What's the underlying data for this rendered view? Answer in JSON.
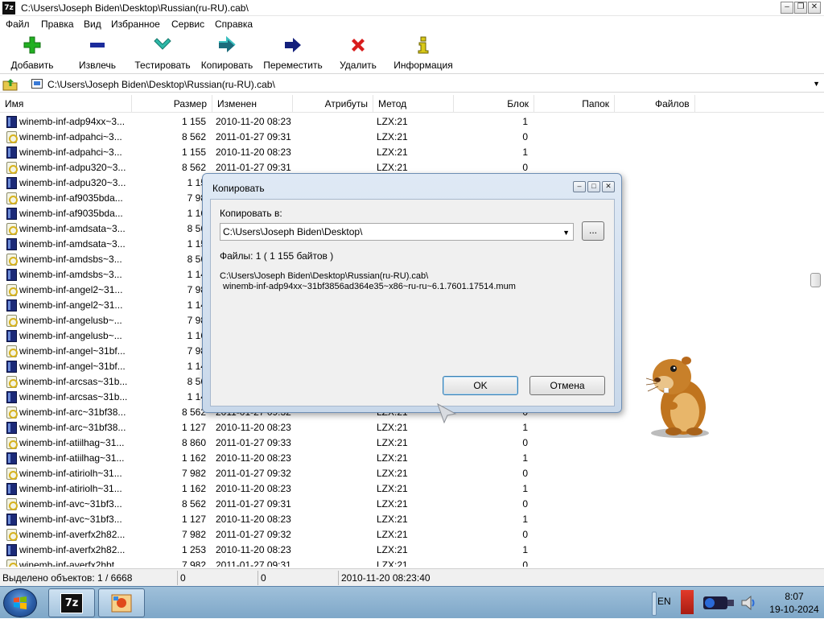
{
  "window": {
    "title": "C:\\Users\\Joseph Biden\\Desktop\\Russian(ru-RU).cab\\",
    "app_icon_text": "7z"
  },
  "menu": [
    "Файл",
    "Правка",
    "Вид",
    "Избранное",
    "Сервис",
    "Справка"
  ],
  "toolbar": [
    {
      "label": "Добавить",
      "icon": "plus-icon",
      "color": "#22b022"
    },
    {
      "label": "Извлечь",
      "icon": "minus-icon",
      "color": "#1c2c9c"
    },
    {
      "label": "Тестировать",
      "icon": "check-icon",
      "color": "#2eb8a8"
    },
    {
      "label": "Копировать",
      "icon": "copy-arrow-icon",
      "color": "#1c6c7c"
    },
    {
      "label": "Переместить",
      "icon": "move-arrow-icon",
      "color": "#14207c"
    },
    {
      "label": "Удалить",
      "icon": "delete-x-icon",
      "color": "#d81c1c"
    },
    {
      "label": "Информация",
      "icon": "info-icon",
      "color": "#d8c818"
    }
  ],
  "address": "C:\\Users\\Joseph Biden\\Desktop\\Russian(ru-RU).cab\\",
  "columns": [
    "Имя",
    "Размер",
    "Изменен",
    "Атрибуты",
    "Метод",
    "Блок",
    "Папок",
    "Файлов"
  ],
  "rows": [
    {
      "name": "winemb-inf-adp94xx~3...",
      "size": "1 155",
      "modified": "2010-11-20 08:23",
      "method": "LZX:21",
      "block": "1",
      "icon": "doc"
    },
    {
      "name": "winemb-inf-adpahci~3...",
      "size": "8 562",
      "modified": "2011-01-27 09:31",
      "method": "LZX:21",
      "block": "0",
      "icon": "cfg"
    },
    {
      "name": "winemb-inf-adpahci~3...",
      "size": "1 155",
      "modified": "2010-11-20 08:23",
      "method": "LZX:21",
      "block": "1",
      "icon": "doc"
    },
    {
      "name": "winemb-inf-adpu320~3...",
      "size": "8 562",
      "modified": "2011-01-27 09:31",
      "method": "LZX:21",
      "block": "0",
      "icon": "cfg"
    },
    {
      "name": "winemb-inf-adpu320~3...",
      "size": "1 15",
      "modified": "",
      "method": "",
      "block": "",
      "icon": "doc"
    },
    {
      "name": "winemb-inf-af9035bda...",
      "size": "7 98",
      "modified": "",
      "method": "",
      "block": "",
      "icon": "cfg"
    },
    {
      "name": "winemb-inf-af9035bda...",
      "size": "1 16",
      "modified": "",
      "method": "",
      "block": "",
      "icon": "doc"
    },
    {
      "name": "winemb-inf-amdsata~3...",
      "size": "8 56",
      "modified": "",
      "method": "",
      "block": "",
      "icon": "cfg"
    },
    {
      "name": "winemb-inf-amdsata~3...",
      "size": "1 15",
      "modified": "",
      "method": "",
      "block": "",
      "icon": "doc"
    },
    {
      "name": "winemb-inf-amdsbs~3...",
      "size": "8 56",
      "modified": "",
      "method": "",
      "block": "",
      "icon": "cfg"
    },
    {
      "name": "winemb-inf-amdsbs~3...",
      "size": "1 14",
      "modified": "",
      "method": "",
      "block": "",
      "icon": "doc"
    },
    {
      "name": "winemb-inf-angel2~31...",
      "size": "7 98",
      "modified": "",
      "method": "",
      "block": "",
      "icon": "cfg"
    },
    {
      "name": "winemb-inf-angel2~31...",
      "size": "1 14",
      "modified": "",
      "method": "",
      "block": "",
      "icon": "doc"
    },
    {
      "name": "winemb-inf-angelusb~...",
      "size": "7 98",
      "modified": "",
      "method": "",
      "block": "",
      "icon": "cfg"
    },
    {
      "name": "winemb-inf-angelusb~...",
      "size": "1 16",
      "modified": "",
      "method": "",
      "block": "",
      "icon": "doc"
    },
    {
      "name": "winemb-inf-angel~31bf...",
      "size": "7 98",
      "modified": "",
      "method": "",
      "block": "",
      "icon": "cfg"
    },
    {
      "name": "winemb-inf-angel~31bf...",
      "size": "1 14",
      "modified": "",
      "method": "",
      "block": "",
      "icon": "doc"
    },
    {
      "name": "winemb-inf-arcsas~31b...",
      "size": "8 56",
      "modified": "",
      "method": "",
      "block": "",
      "icon": "cfg"
    },
    {
      "name": "winemb-inf-arcsas~31b...",
      "size": "1 14",
      "modified": "",
      "method": "",
      "block": "",
      "icon": "doc"
    },
    {
      "name": "winemb-inf-arc~31bf38...",
      "size": "8 562",
      "modified": "2011-01-27 09:32",
      "method": "LZX:21",
      "block": "0",
      "icon": "cfg"
    },
    {
      "name": "winemb-inf-arc~31bf38...",
      "size": "1 127",
      "modified": "2010-11-20 08:23",
      "method": "LZX:21",
      "block": "1",
      "icon": "doc"
    },
    {
      "name": "winemb-inf-atiilhag~31...",
      "size": "8 860",
      "modified": "2011-01-27 09:33",
      "method": "LZX:21",
      "block": "0",
      "icon": "cfg"
    },
    {
      "name": "winemb-inf-atiilhag~31...",
      "size": "1 162",
      "modified": "2010-11-20 08:23",
      "method": "LZX:21",
      "block": "1",
      "icon": "doc"
    },
    {
      "name": "winemb-inf-atiriolh~31...",
      "size": "7 982",
      "modified": "2011-01-27 09:32",
      "method": "LZX:21",
      "block": "0",
      "icon": "cfg"
    },
    {
      "name": "winemb-inf-atiriolh~31...",
      "size": "1 162",
      "modified": "2010-11-20 08:23",
      "method": "LZX:21",
      "block": "1",
      "icon": "doc"
    },
    {
      "name": "winemb-inf-avc~31bf3...",
      "size": "8 562",
      "modified": "2011-01-27 09:31",
      "method": "LZX:21",
      "block": "0",
      "icon": "cfg"
    },
    {
      "name": "winemb-inf-avc~31bf3...",
      "size": "1 127",
      "modified": "2010-11-20 08:23",
      "method": "LZX:21",
      "block": "1",
      "icon": "doc"
    },
    {
      "name": "winemb-inf-averfx2h82...",
      "size": "7 982",
      "modified": "2011-01-27 09:32",
      "method": "LZX:21",
      "block": "0",
      "icon": "cfg"
    },
    {
      "name": "winemb-inf-averfx2h82...",
      "size": "1 253",
      "modified": "2010-11-20 08:23",
      "method": "LZX:21",
      "block": "1",
      "icon": "doc"
    },
    {
      "name": "winemb-inf-averfx2hbt...",
      "size": "7 982",
      "modified": "2011-01-27 09:31",
      "method": "LZX:21",
      "block": "0",
      "icon": "cfg"
    }
  ],
  "status": {
    "selected": "Выделено объектов: 1 / 6668",
    "size1": "0",
    "size2": "0",
    "datetime": "2010-11-20 08:23:40"
  },
  "dialog": {
    "title": "Копировать",
    "copy_to_label": "Копировать в:",
    "destination": "C:\\Users\\Joseph Biden\\Desktop\\",
    "browse_label": "...",
    "files_info": "Файлы: 1 ( 1 155 байтов )",
    "source_path": "C:\\Users\\Joseph Biden\\Desktop\\Russian(ru-RU).cab\\",
    "source_file": "winemb-inf-adp94xx~31bf3856ad364e35~x86~ru-ru~6.1.7601.17514.mum",
    "ok_label": "OK",
    "cancel_label": "Отмена"
  },
  "taskbar": {
    "lang": "EN",
    "time": "8:07",
    "date": "19-10-2024",
    "seven_zip_icon_text": "7z"
  },
  "colors": {
    "accent": "#3c7fb1",
    "dialog_frame": "#c8d8ea",
    "taskbar": "#8fb4d2"
  }
}
